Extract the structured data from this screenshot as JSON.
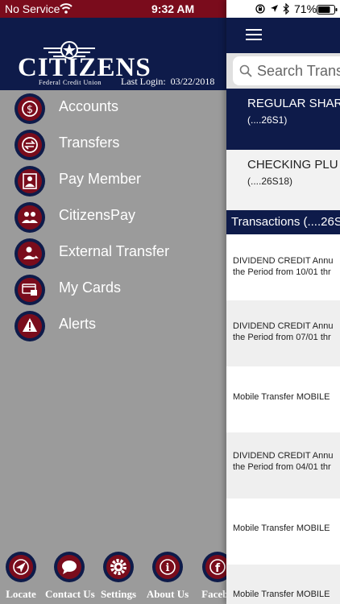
{
  "status_bar": {
    "carrier": "No Service",
    "time": "9:32 AM",
    "battery": "71%"
  },
  "brand": {
    "name": "CITIZENS",
    "subtitle": "Federal Credit Union",
    "last_login_label": "Last Login:",
    "last_login_date": "03/22/2018"
  },
  "menu": [
    {
      "label": "Accounts",
      "icon": "dollar-icon"
    },
    {
      "label": "Transfers",
      "icon": "transfer-icon"
    },
    {
      "label": "Pay Member",
      "icon": "pay-member-icon"
    },
    {
      "label": "CitizensPay",
      "icon": "citizens-pay-icon"
    },
    {
      "label": "External Transfer",
      "icon": "external-transfer-icon"
    },
    {
      "label": "My Cards",
      "icon": "card-icon"
    },
    {
      "label": "Alerts",
      "icon": "alert-icon"
    }
  ],
  "footer": [
    {
      "label": "Locate",
      "icon": "locate-icon"
    },
    {
      "label": "Contact Us",
      "icon": "chat-icon"
    },
    {
      "label": "Settings",
      "icon": "gear-icon"
    },
    {
      "label": "About Us",
      "icon": "info-icon"
    },
    {
      "label": "Facebo",
      "icon": "facebook-icon"
    }
  ],
  "search": {
    "placeholder": "Search Trans"
  },
  "accounts": [
    {
      "name": "REGULAR SHAR",
      "number": "(....26S1)",
      "selected": true
    },
    {
      "name": "CHECKING PLU",
      "number": "(....26S18)",
      "selected": false
    }
  ],
  "transactions_header": "Transactions (....26S",
  "transactions": [
    {
      "line1": "DIVIDEND CREDIT Annu",
      "line2": "the Period from 10/01 thr"
    },
    {
      "line1": "DIVIDEND CREDIT Annu",
      "line2": "the Period from 07/01 thr"
    },
    {
      "line1": "Mobile Transfer MOBILE",
      "line2": ""
    },
    {
      "line1": "DIVIDEND CREDIT Annu",
      "line2": "the Period from 04/01 thr"
    },
    {
      "line1": "Mobile Transfer MOBILE",
      "line2": ""
    },
    {
      "line1": "Mobile Transfer MOBILE",
      "line2": ""
    }
  ],
  "colors": {
    "navy": "#0e1b4a",
    "maroon": "#7a0c1c",
    "drawer_gray": "#9b9b9b"
  }
}
